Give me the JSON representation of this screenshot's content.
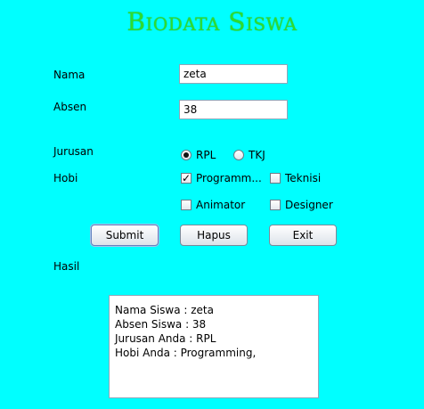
{
  "title": "Biodata Siswa",
  "form": {
    "nama_label": "Nama",
    "nama_value": "zeta",
    "absen_label": "Absen",
    "absen_value": "38",
    "jurusan_label": "Jurusan",
    "jurusan_options": [
      {
        "label": "RPL",
        "selected": true
      },
      {
        "label": "TKJ",
        "selected": false
      }
    ],
    "hobi_label": "Hobi",
    "hobi_options": [
      {
        "label": "Programm...",
        "checked": true
      },
      {
        "label": "Teknisi",
        "checked": false
      },
      {
        "label": "Animator",
        "checked": false
      },
      {
        "label": "Designer",
        "checked": false
      }
    ]
  },
  "buttons": {
    "submit": "Submit",
    "hapus": "Hapus",
    "exit": "Exit"
  },
  "result": {
    "label": "Hasil",
    "lines": [
      "Nama Siswa : zeta",
      "Absen Siswa : 38",
      "Jurusan Anda : RPL",
      "Hobi Anda : Programming,"
    ]
  }
}
